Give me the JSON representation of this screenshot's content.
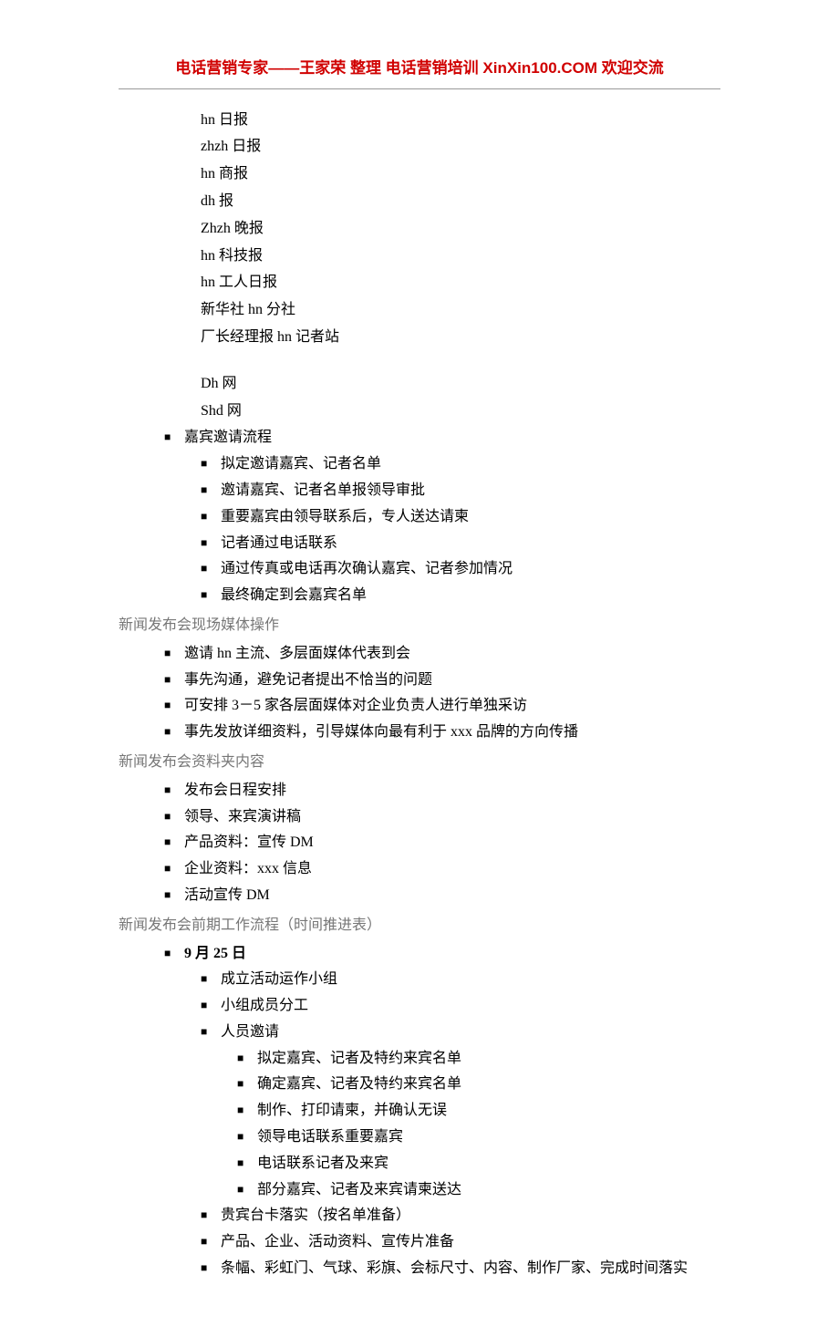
{
  "header": {
    "text": "电话营销专家——王家荣 整理 电话营销培训 XinXin100.COM 欢迎交流"
  },
  "mediaList": {
    "items": [
      "hn 日报",
      "zhzh 日报",
      "hn 商报",
      "dh 报",
      "Zhzh 晚报",
      "hn 科技报",
      "hn 工人日报",
      "新华社 hn 分社",
      "厂长经理报 hn 记者站"
    ],
    "items2": [
      "Dh 网",
      "Shd 网"
    ]
  },
  "guestInvite": {
    "title": "嘉宾邀请流程",
    "items": [
      "拟定邀请嘉宾、记者名单",
      "邀请嘉宾、记者名单报领导审批",
      "重要嘉宾由领导联系后，专人送达请柬",
      "记者通过电话联系",
      "通过传真或电话再次确认嘉宾、记者参加情况",
      "最终确定到会嘉宾名单"
    ]
  },
  "siteMedia": {
    "title": "新闻发布会现场媒体操作",
    "items": [
      "邀请 hn 主流、多层面媒体代表到会",
      "事先沟通，避免记者提出不恰当的问题",
      "可安排 3－5 家各层面媒体对企业负责人进行单独采访",
      "事先发放详细资料，引导媒体向最有利于 xxx 品牌的方向传播"
    ]
  },
  "folderContent": {
    "title": "新闻发布会资料夹内容",
    "items": [
      "发布会日程安排",
      "领导、来宾演讲稿",
      "产品资料：宣传 DM",
      "企业资料：xxx 信息",
      "活动宣传 DM"
    ]
  },
  "preWork": {
    "title": "新闻发布会前期工作流程（时间推进表）",
    "dateLabel": "9 月 25 日",
    "l2Items1": [
      "成立活动运作小组",
      "小组成员分工",
      "人员邀请"
    ],
    "l3Items": [
      "拟定嘉宾、记者及特约来宾名单",
      "确定嘉宾、记者及特约来宾名单",
      "制作、打印请柬，并确认无误",
      "领导电话联系重要嘉宾",
      "电话联系记者及来宾",
      "部分嘉宾、记者及来宾请柬送达"
    ],
    "l2Items2": [
      "贵宾台卡落实（按名单准备）",
      "产品、企业、活动资料、宣传片准备",
      "条幅、彩虹门、气球、彩旗、会标尺寸、内容、制作厂家、完成时间落实"
    ]
  }
}
